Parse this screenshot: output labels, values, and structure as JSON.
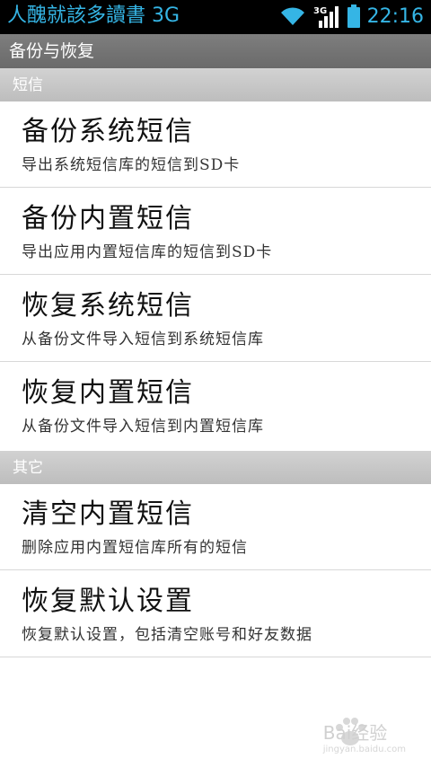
{
  "statusbar": {
    "carrier": "人醜就該多讀書 3G",
    "network_label": "3G",
    "time": "22:16",
    "icons": [
      "wifi-icon",
      "signal-icon",
      "battery-icon"
    ],
    "accent": "#35b5e5"
  },
  "titlebar": {
    "title": "备份与恢复"
  },
  "sections": [
    {
      "label": "短信",
      "items": [
        {
          "title": "备份系统短信",
          "summary": "导出系统短信库的短信到SD卡"
        },
        {
          "title": "备份内置短信",
          "summary": "导出应用内置短信库的短信到SD卡"
        },
        {
          "title": "恢复系统短信",
          "summary": "从备份文件导入短信到系统短信库"
        },
        {
          "title": "恢复内置短信",
          "summary": "从备份文件导入短信到内置短信库"
        }
      ]
    },
    {
      "label": "其它",
      "items": [
        {
          "title": "清空内置短信",
          "summary": "删除应用内置短信库所有的短信"
        },
        {
          "title": "恢复默认设置",
          "summary": "恢复默认设置，包括清空账号和好友数据"
        }
      ]
    }
  ],
  "watermark": {
    "text": "Bai经验",
    "sub": "jingyan.baidu.com"
  }
}
